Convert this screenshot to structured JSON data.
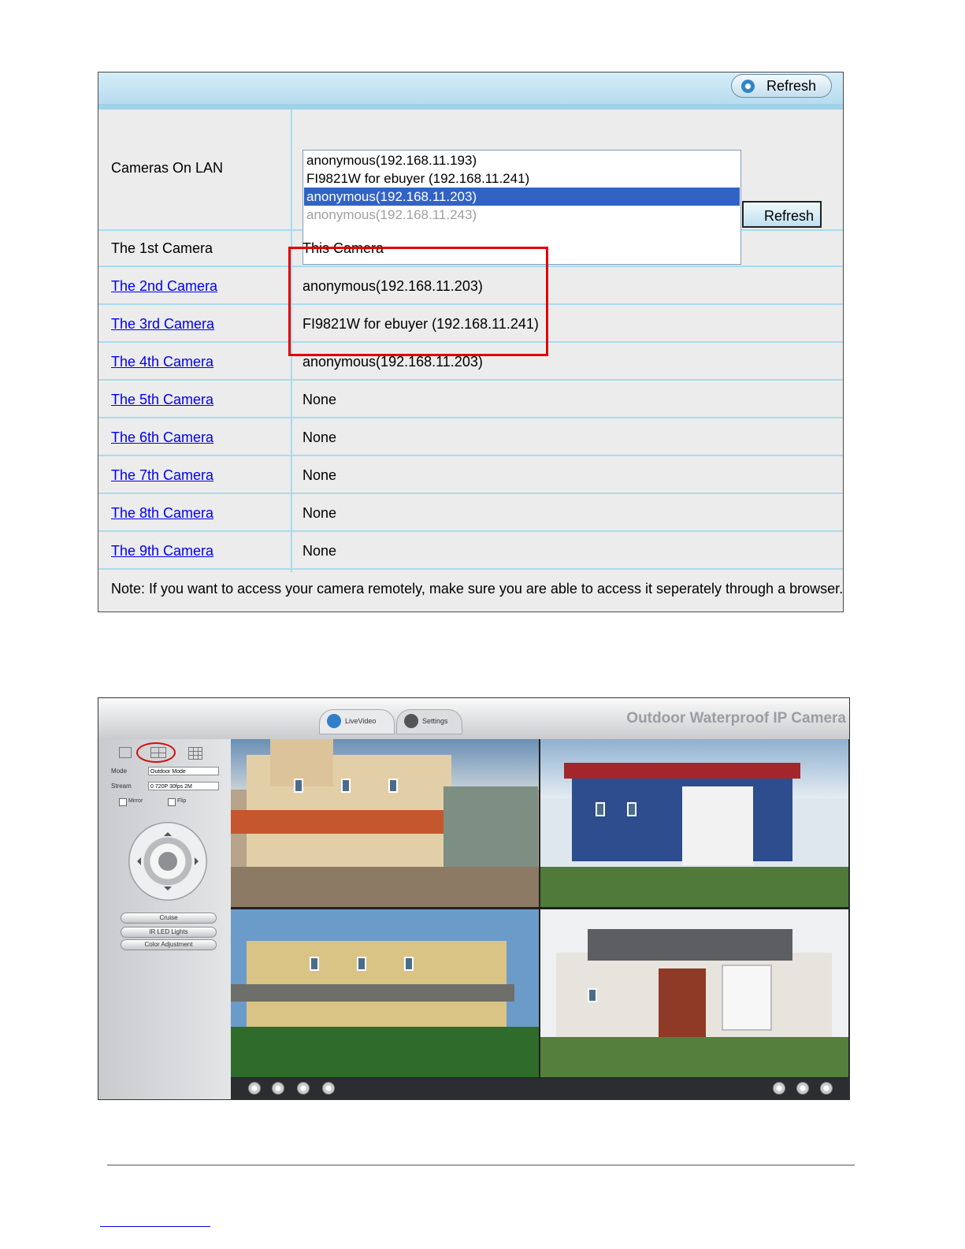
{
  "panel": {
    "header_refresh_label": "Refresh",
    "lan_label": "Cameras On LAN",
    "lan_list": [
      "anonymous(192.168.11.193)",
      "FI9821W for ebuyer (192.168.11.241)",
      "anonymous(192.168.11.203)",
      "anonymous(192.168.11.243)"
    ],
    "lan_selected_index": 2,
    "lan_refresh_label": "Refresh",
    "rows": [
      {
        "label": "The 1st Camera",
        "value": "This Camera"
      },
      {
        "label": "The 2nd Camera",
        "value": "anonymous(192.168.11.203)"
      },
      {
        "label": "The 3rd Camera",
        "value": "FI9821W for ebuyer (192.168.11.241)"
      },
      {
        "label": "The 4th Camera",
        "value": "anonymous(192.168.11.203)"
      },
      {
        "label": "The 5th Camera",
        "value": "None"
      },
      {
        "label": "The 6th Camera",
        "value": "None"
      },
      {
        "label": "The 7th Camera",
        "value": "None"
      },
      {
        "label": "The 8th Camera",
        "value": "None"
      },
      {
        "label": "The 9th Camera",
        "value": "None"
      }
    ],
    "note": "Note: If you want to access your camera remotely, make sure you are able to access it seperately through a browser.",
    "colors": {
      "header": "#b7dcee",
      "grid_line": "#a9dbef",
      "selected": "#3163c5",
      "highlight_box": "#e00000",
      "link": "#0000ee"
    }
  },
  "live": {
    "brand": "Outdoor Waterproof IP Camera",
    "tabs": [
      "LiveVideo",
      "Settings"
    ],
    "mode_label": "Mode",
    "mode_value": "Outdoor Mode",
    "stream_label": "Stream",
    "stream_value": "0 720P 30fps 2M",
    "mirror_label": "Mirror",
    "flip_label": "Flip",
    "buttons": [
      "Cruise",
      "IR LED Lights",
      "Color Adjustment"
    ]
  }
}
